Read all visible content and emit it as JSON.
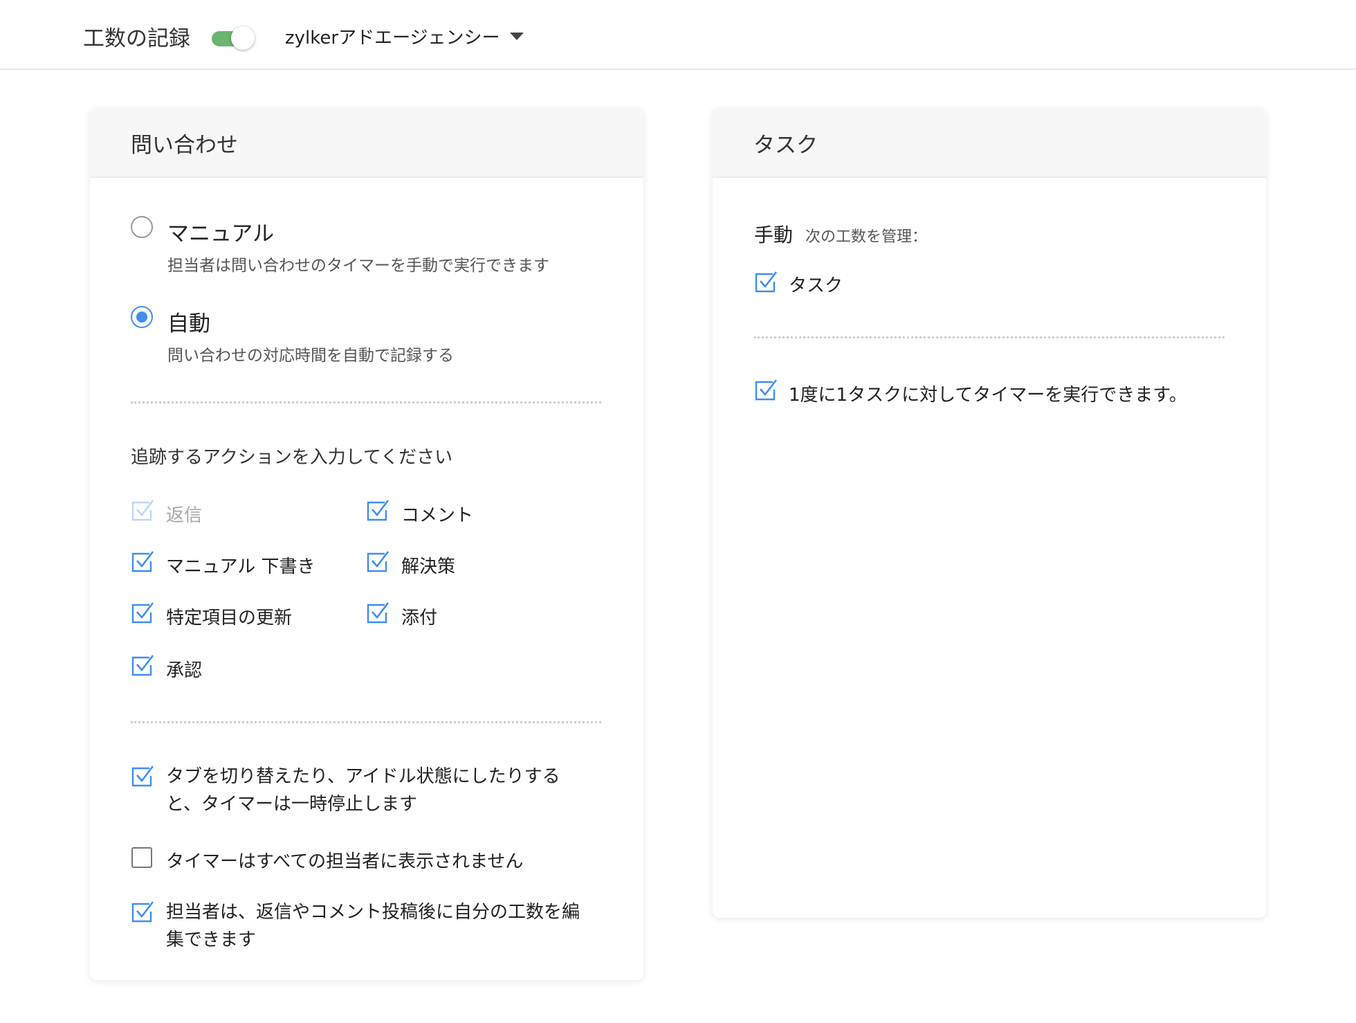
{
  "header": {
    "title": "工数の記録",
    "toggle_on": true,
    "department": "zylkerアドエージェンシー"
  },
  "tickets_card": {
    "title": "問い合わせ",
    "manual": {
      "label": "マニュアル",
      "description": "担当者は問い合わせのタイマーを手動で実行できます",
      "selected": false
    },
    "auto": {
      "label": "自動",
      "description": "問い合わせの対応時間を自動で記録する",
      "selected": true
    },
    "actions_label": "追跡するアクションを入力してください",
    "actions": [
      {
        "label": "返信",
        "checked": true,
        "disabled": true
      },
      {
        "label": "コメント",
        "checked": true
      },
      {
        "label": "マニュアル 下書き",
        "checked": true
      },
      {
        "label": "解決策",
        "checked": true
      },
      {
        "label": "特定項目の更新",
        "checked": true
      },
      {
        "label": "添付",
        "checked": true
      },
      {
        "label": "承認",
        "checked": true
      }
    ],
    "options": [
      {
        "line1": "タブを切り替えたり、アイドル状態にしたりする",
        "line2": "と、タイマーは一時停止します",
        "checked": true
      },
      {
        "line1": "タイマーはすべての担当者に表示されません",
        "checked": false
      },
      {
        "line1": "担当者は、返信やコメント投稿後に自分の工数を編",
        "line2": "集できます",
        "checked": true
      }
    ]
  },
  "tasks_card": {
    "title": "タスク",
    "manual_label": "手動",
    "manage_label": "次の工数を管理：",
    "task_item": "タスク",
    "single_timer": "1度に1タスクに対してタイマーを実行できます。"
  },
  "colors": {
    "accent": "#3d8ef0",
    "toggle": "#6bb56e",
    "disabled": "#b9d7f7"
  }
}
